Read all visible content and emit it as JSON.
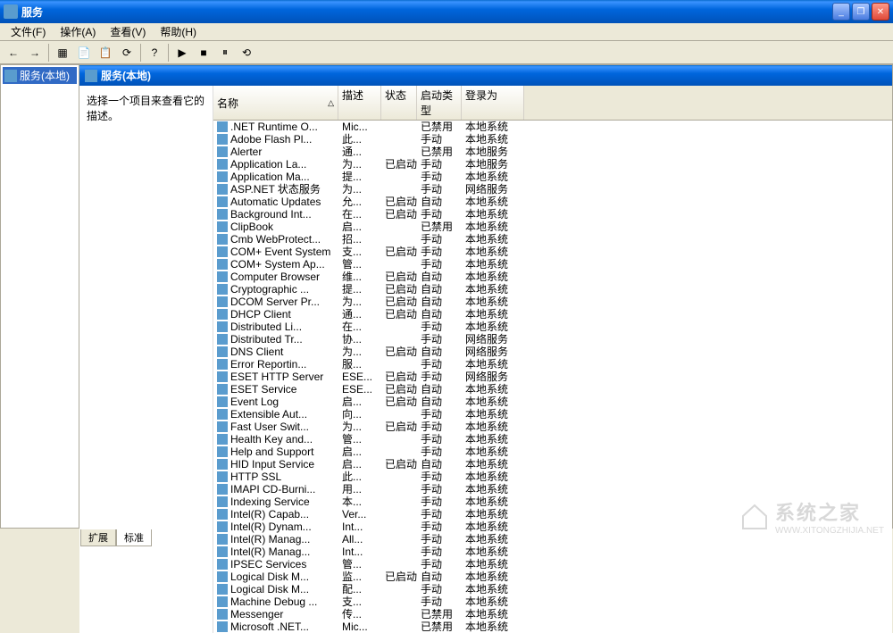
{
  "window": {
    "title": "服务"
  },
  "menu": {
    "file": "文件(F)",
    "action": "操作(A)",
    "view": "查看(V)",
    "help": "帮助(H)"
  },
  "tree": {
    "root": "服务(本地)"
  },
  "header": {
    "label": "服务(本地)"
  },
  "info": {
    "hint": "选择一个项目来查看它的描述。"
  },
  "columns": {
    "name": "名称",
    "desc": "描述",
    "status": "状态",
    "start": "启动类型",
    "logon": "登录为"
  },
  "tabs": {
    "extended": "扩展",
    "standard": "标准"
  },
  "watermark": {
    "text": "系统之家",
    "url": "WWW.XITONGZHIJIA.NET"
  },
  "services": [
    {
      "name": ".NET Runtime O...",
      "desc": "Mic...",
      "status": "",
      "start": "已禁用",
      "logon": "本地系统"
    },
    {
      "name": "Adobe Flash Pl...",
      "desc": "此...",
      "status": "",
      "start": "手动",
      "logon": "本地系统"
    },
    {
      "name": "Alerter",
      "desc": "通...",
      "status": "",
      "start": "已禁用",
      "logon": "本地服务"
    },
    {
      "name": "Application La...",
      "desc": "为...",
      "status": "已启动",
      "start": "手动",
      "logon": "本地服务"
    },
    {
      "name": "Application Ma...",
      "desc": "提...",
      "status": "",
      "start": "手动",
      "logon": "本地系统"
    },
    {
      "name": "ASP.NET 状态服务",
      "desc": "为...",
      "status": "",
      "start": "手动",
      "logon": "网络服务"
    },
    {
      "name": "Automatic Updates",
      "desc": "允...",
      "status": "已启动",
      "start": "自动",
      "logon": "本地系统"
    },
    {
      "name": "Background Int...",
      "desc": "在...",
      "status": "已启动",
      "start": "手动",
      "logon": "本地系统"
    },
    {
      "name": "ClipBook",
      "desc": "启...",
      "status": "",
      "start": "已禁用",
      "logon": "本地系统"
    },
    {
      "name": "Cmb WebProtect...",
      "desc": "招...",
      "status": "",
      "start": "手动",
      "logon": "本地系统"
    },
    {
      "name": "COM+ Event System",
      "desc": "支...",
      "status": "已启动",
      "start": "手动",
      "logon": "本地系统"
    },
    {
      "name": "COM+ System Ap...",
      "desc": "管...",
      "status": "",
      "start": "手动",
      "logon": "本地系统"
    },
    {
      "name": "Computer Browser",
      "desc": "维...",
      "status": "已启动",
      "start": "自动",
      "logon": "本地系统"
    },
    {
      "name": "Cryptographic ...",
      "desc": "提...",
      "status": "已启动",
      "start": "自动",
      "logon": "本地系统"
    },
    {
      "name": "DCOM Server Pr...",
      "desc": "为...",
      "status": "已启动",
      "start": "自动",
      "logon": "本地系统"
    },
    {
      "name": "DHCP Client",
      "desc": "通...",
      "status": "已启动",
      "start": "自动",
      "logon": "本地系统"
    },
    {
      "name": "Distributed Li...",
      "desc": "在...",
      "status": "",
      "start": "手动",
      "logon": "本地系统"
    },
    {
      "name": "Distributed Tr...",
      "desc": "协...",
      "status": "",
      "start": "手动",
      "logon": "网络服务"
    },
    {
      "name": "DNS Client",
      "desc": "为...",
      "status": "已启动",
      "start": "自动",
      "logon": "网络服务"
    },
    {
      "name": "Error Reportin...",
      "desc": "服...",
      "status": "",
      "start": "手动",
      "logon": "本地系统"
    },
    {
      "name": "ESET HTTP Server",
      "desc": "ESE...",
      "status": "已启动",
      "start": "手动",
      "logon": "网络服务"
    },
    {
      "name": "ESET Service",
      "desc": "ESE...",
      "status": "已启动",
      "start": "自动",
      "logon": "本地系统"
    },
    {
      "name": "Event Log",
      "desc": "启...",
      "status": "已启动",
      "start": "自动",
      "logon": "本地系统"
    },
    {
      "name": "Extensible Aut...",
      "desc": "向...",
      "status": "",
      "start": "手动",
      "logon": "本地系统"
    },
    {
      "name": "Fast User Swit...",
      "desc": "为...",
      "status": "已启动",
      "start": "手动",
      "logon": "本地系统"
    },
    {
      "name": "Health Key and...",
      "desc": "管...",
      "status": "",
      "start": "手动",
      "logon": "本地系统"
    },
    {
      "name": "Help and Support",
      "desc": "启...",
      "status": "",
      "start": "手动",
      "logon": "本地系统"
    },
    {
      "name": "HID Input Service",
      "desc": "启...",
      "status": "已启动",
      "start": "自动",
      "logon": "本地系统"
    },
    {
      "name": "HTTP SSL",
      "desc": "此...",
      "status": "",
      "start": "手动",
      "logon": "本地系统"
    },
    {
      "name": "IMAPI CD-Burni...",
      "desc": "用...",
      "status": "",
      "start": "手动",
      "logon": "本地系统"
    },
    {
      "name": "Indexing Service",
      "desc": "本...",
      "status": "",
      "start": "手动",
      "logon": "本地系统"
    },
    {
      "name": "Intel(R) Capab...",
      "desc": "Ver...",
      "status": "",
      "start": "手动",
      "logon": "本地系统"
    },
    {
      "name": "Intel(R) Dynam...",
      "desc": "Int...",
      "status": "",
      "start": "手动",
      "logon": "本地系统"
    },
    {
      "name": "Intel(R) Manag...",
      "desc": "All...",
      "status": "",
      "start": "手动",
      "logon": "本地系统"
    },
    {
      "name": "Intel(R) Manag...",
      "desc": "Int...",
      "status": "",
      "start": "手动",
      "logon": "本地系统"
    },
    {
      "name": "IPSEC Services",
      "desc": "管...",
      "status": "",
      "start": "手动",
      "logon": "本地系统"
    },
    {
      "name": "Logical Disk M...",
      "desc": "监...",
      "status": "已启动",
      "start": "自动",
      "logon": "本地系统"
    },
    {
      "name": "Logical Disk M...",
      "desc": "配...",
      "status": "",
      "start": "手动",
      "logon": "本地系统"
    },
    {
      "name": "Machine Debug ...",
      "desc": "支...",
      "status": "",
      "start": "手动",
      "logon": "本地系统"
    },
    {
      "name": "Messenger",
      "desc": "传...",
      "status": "",
      "start": "已禁用",
      "logon": "本地系统"
    },
    {
      "name": "Microsoft .NET...",
      "desc": "Mic...",
      "status": "",
      "start": "已禁用",
      "logon": "本地系统"
    }
  ]
}
